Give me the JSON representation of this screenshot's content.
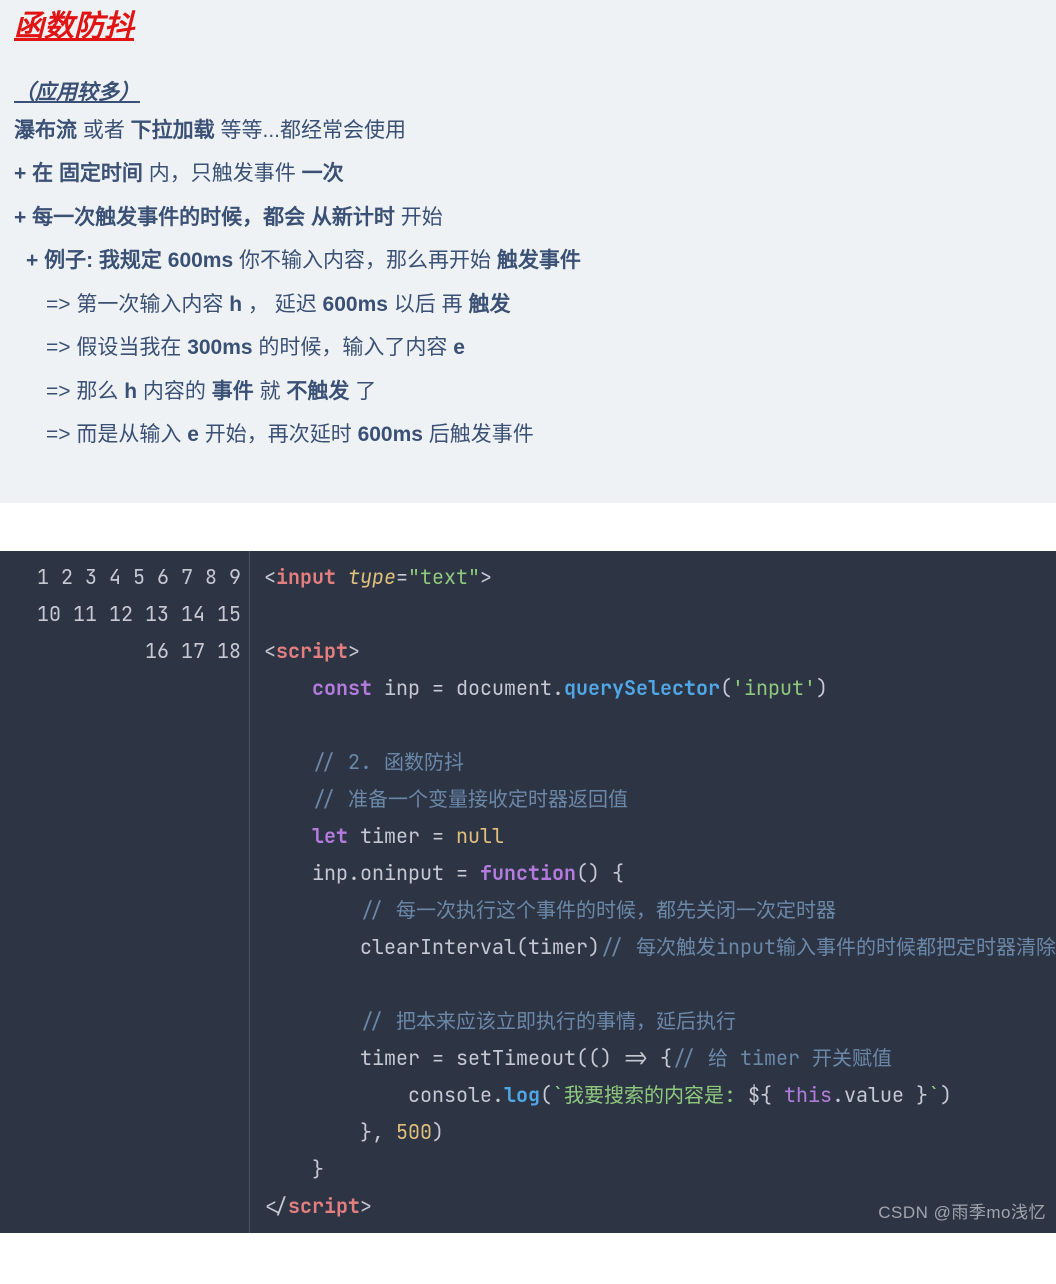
{
  "header": {
    "title": "函数防抖 "
  },
  "intro": {
    "subtitle": "（应用较多）",
    "line1_a": "瀑布流",
    "line1_b": " 或者 ",
    "line1_c": "下拉加载",
    "line1_d": " 等等...都经常会使用",
    "bullet1_a": "+ 在 ",
    "bullet1_b": "固定时间",
    "bullet1_c": " 内，只触发事件 ",
    "bullet1_d": "一次",
    "bullet2_a": "+ 每一次触发事件的时候，都会 ",
    "bullet2_b": "从新计时",
    "bullet2_c": " 开始",
    "bullet3_a": "+ 例子: 我规定  ",
    "bullet3_b": "600ms",
    "bullet3_c": "  你不输入内容，那么再开始 ",
    "bullet3_d": "触发事件",
    "step1_a": "=>  第一次输入内容  ",
    "step1_b": "h",
    "step1_c": " ， 延迟 ",
    "step1_d": "600ms",
    "step1_e": "  以后 再 ",
    "step1_f": "触发",
    "step2_a": "=>  假设当我在 ",
    "step2_b": "300ms",
    "step2_c": " 的时候，输入了内容  ",
    "step2_d": "e",
    "step3_a": "=>  那么  ",
    "step3_b": "h",
    "step3_c": "  内容的 ",
    "step3_d": "事件",
    "step3_e": " 就 ",
    "step3_f": "不触发",
    "step3_g": " 了",
    "step4_a": "=>  而是从输入  ",
    "step4_b": "e",
    "step4_c": "  开始，再次延时 ",
    "step4_d": "600ms",
    "step4_e": " 后触发事件"
  },
  "code": {
    "gutter": "1\n2\n3\n4\n5\n6\n7\n8\n9\n10\n11\n12\n13\n14\n15\n16\n17\n18",
    "l1": {
      "a": "<",
      "b": "input",
      "c": " ",
      "d": "type",
      "e": "=",
      "f": "\"text\"",
      "g": ">"
    },
    "l3": {
      "a": "<",
      "b": "script",
      "c": ">"
    },
    "l4": {
      "a": "    ",
      "b": "const",
      "c": " inp = document.",
      "d": "querySelector",
      "e": "(",
      "f": "'input'",
      "g": ")"
    },
    "l6": {
      "a": "    ",
      "b": "// 2. 函数防抖"
    },
    "l7": {
      "a": "    ",
      "b": "// 准备一个变量接收定时器返回值"
    },
    "l8": {
      "a": "    ",
      "b": "let",
      "c": " timer = ",
      "d": "null"
    },
    "l9": {
      "a": "    inp.oninput = ",
      "b": "function",
      "c": "() {"
    },
    "l10": {
      "a": "        ",
      "b": "// 每一次执行这个事件的时候，都先关闭一次定时器"
    },
    "l11": {
      "a": "        clearInterval(timer)",
      "b": "// 每次触发input输入事件的时候都把定时器清除"
    },
    "l13": {
      "a": "        ",
      "b": "// 把本来应该立即执行的事情，延后执行"
    },
    "l14": {
      "a": "        timer = setTimeout(() => {",
      "b": "// 给 timer 开关赋值"
    },
    "l15": {
      "a": "            console.",
      "b": "log",
      "c": "(",
      "d": "`我要搜索的内容是: ",
      "e": "${ ",
      "f": "this",
      "g": ".value }",
      "h": "`",
      "i": ")"
    },
    "l16": {
      "a": "        }, ",
      "b": "500",
      "c": ")"
    },
    "l17": {
      "a": "    }"
    },
    "l18": {
      "a": "</",
      "b": "script",
      "c": ">"
    }
  },
  "watermark": "CSDN @雨季mo浅忆"
}
